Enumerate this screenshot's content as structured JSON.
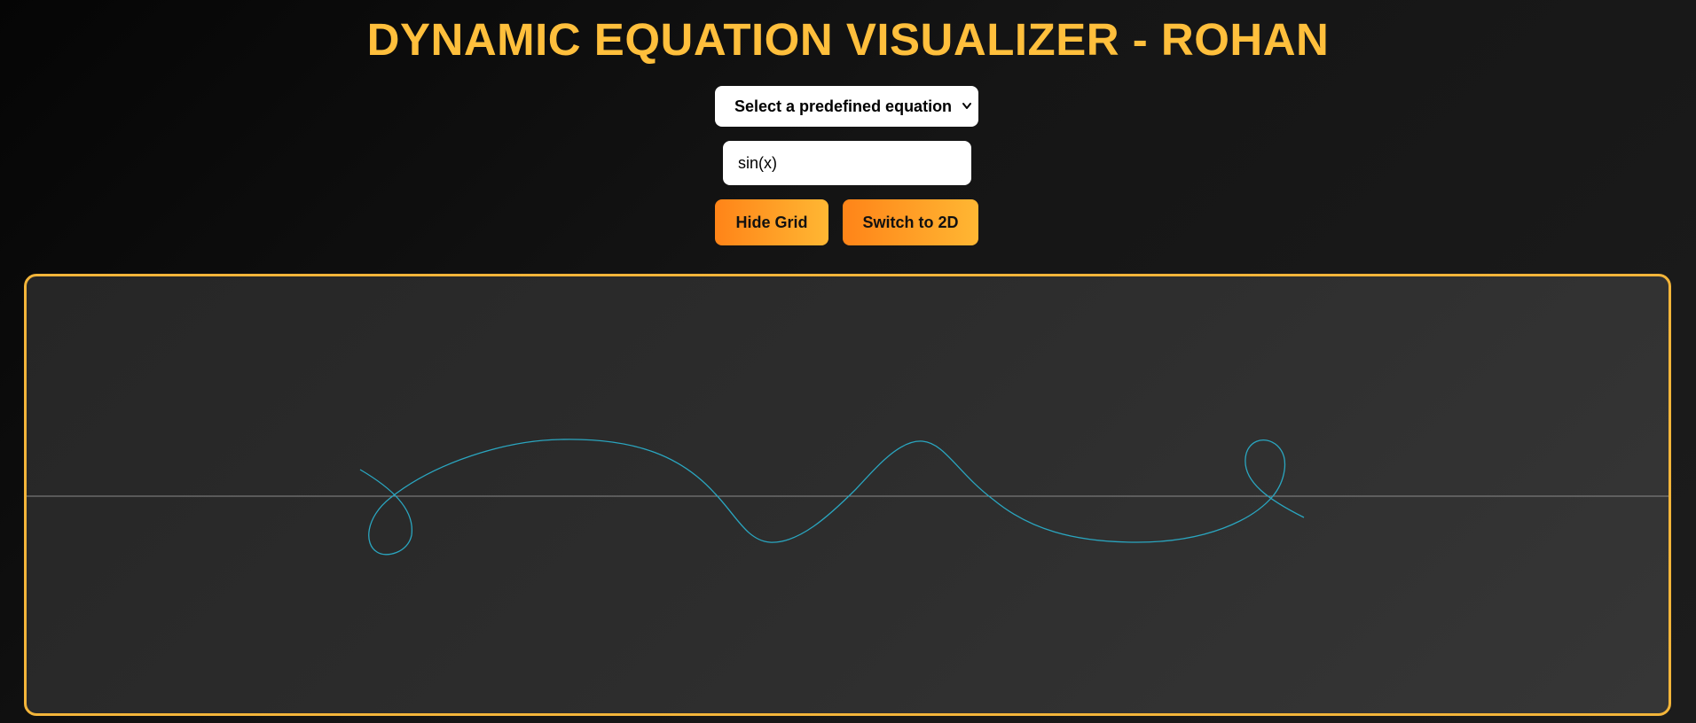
{
  "header": {
    "title": "DYNAMIC EQUATION VISUALIZER - ROHAN"
  },
  "controls": {
    "equation_select": {
      "selected_label": "Select a predefined equation",
      "icon": "chevron-down-icon"
    },
    "equation_input": {
      "value": "sin(x)"
    },
    "grid_button_label": "Hide Grid",
    "mode_button_label": "Switch to 2D"
  },
  "plot": {
    "grid_visible": true,
    "curve_color": "#2aa6c0",
    "axis_color": "#8a8a8a"
  },
  "colors": {
    "accent": "#ffbf3c",
    "button_gradient_start": "#ff8418",
    "button_gradient_end": "#ffb733",
    "panel_border": "#f3b53a"
  }
}
